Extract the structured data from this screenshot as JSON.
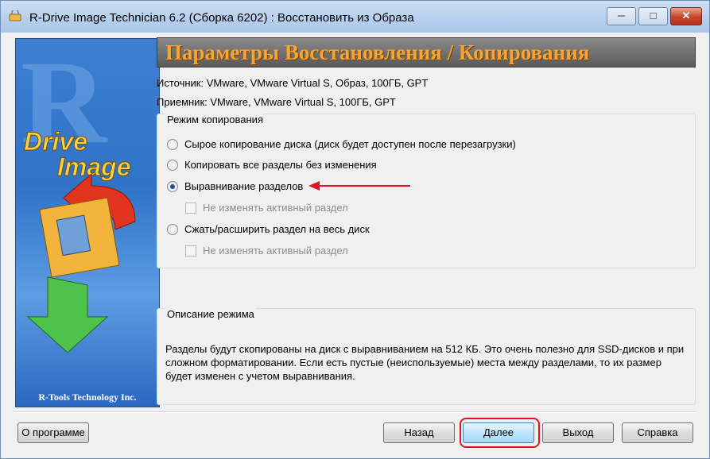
{
  "window": {
    "title": "R-Drive Image Technician 6.2 (Сборка 6202) : Восстановить из Образа",
    "controls": {
      "minimize": "─",
      "maximize": "□",
      "close": "✕"
    }
  },
  "sidebar": {
    "logo_letter": "R",
    "logo_word1": "Drive",
    "logo_word2": "Image",
    "brand": "R-Tools Technology Inc."
  },
  "header": {
    "banner": "Параметры Восстановления / Копирования"
  },
  "info": {
    "source": "Источник: VMware, VMware Virtual S, Образ, 100ГБ, GPT",
    "target": "Приемник: VMware, VMware Virtual S, 100ГБ, GPT"
  },
  "copy_mode": {
    "title": "Режим копирования",
    "options": [
      {
        "label": "Сырое копирование диска (диск будет доступен после перезагрузки)",
        "selected": false
      },
      {
        "label": "Копировать все разделы без изменения",
        "selected": false
      },
      {
        "label": "Выравнивание разделов",
        "selected": true
      },
      {
        "label": "Сжать/расширить раздел на весь диск",
        "selected": false
      }
    ],
    "checkbox_label": "Не изменять активный раздел"
  },
  "description": {
    "title": "Описание режима",
    "text": "Разделы будут скопированы на диск с выравниванием на 512 КБ. Это очень полезно для SSD-дисков и при сложном форматировании. Если есть пустые (неиспользуемые) места между разделами, то их размер будет изменен с учетом выравнивания."
  },
  "buttons": {
    "about": "О программе",
    "back": "Назад",
    "next": "Далее",
    "exit": "Выход",
    "help": "Справка"
  },
  "colors": {
    "annotation_red": "#e0141e",
    "banner_text": "#f7a531",
    "radio_dot": "#1e4f8f"
  }
}
